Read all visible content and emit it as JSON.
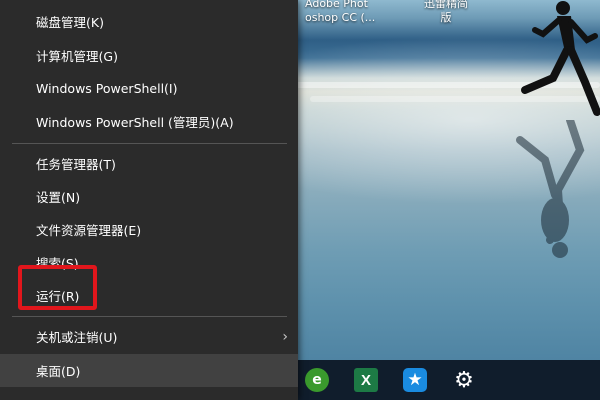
{
  "desktop": {
    "icon_labels": [
      {
        "line1": "Adobe Phot",
        "line2": "oshop CC (..."
      },
      {
        "line1": "迅雷精简",
        "line2": "版"
      }
    ]
  },
  "menu": {
    "items": [
      {
        "label": "磁盘管理(K)"
      },
      {
        "label": "计算机管理(G)"
      },
      {
        "label": "Windows PowerShell(I)"
      },
      {
        "label": "Windows PowerShell (管理员)(A)"
      },
      {
        "label": "任务管理器(T)"
      },
      {
        "label": "设置(N)"
      },
      {
        "label": "文件资源管理器(E)"
      },
      {
        "label": "搜索(S)"
      },
      {
        "label": "运行(R)"
      },
      {
        "label": "关机或注销(U)"
      },
      {
        "label": "桌面(D)"
      }
    ],
    "highlighted_item": "运行(R)",
    "submenu_chevron": "›",
    "colors": {
      "background": "#2b2b2b",
      "active": "#414141",
      "highlight_box": "#e1161c"
    }
  },
  "taskbar": {
    "icons": [
      {
        "name": "ie-icon",
        "glyph": "e"
      },
      {
        "name": "excel-icon",
        "glyph": "X"
      },
      {
        "name": "star-app-icon",
        "glyph": "★"
      },
      {
        "name": "settings-gear-icon",
        "glyph": "⚙"
      }
    ]
  }
}
